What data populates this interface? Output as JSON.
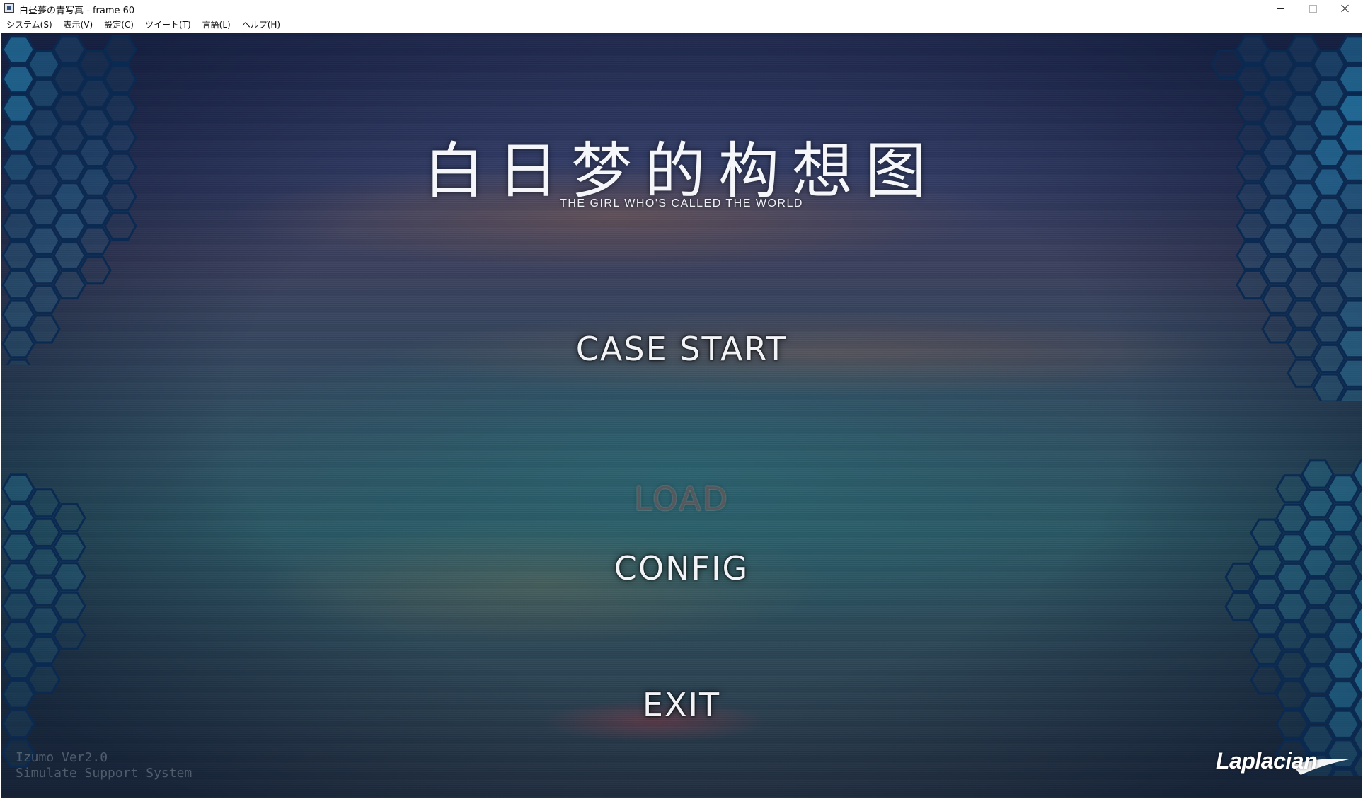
{
  "window": {
    "title": "白昼夢の青写真 - frame 60",
    "icon": "app-icon",
    "controls": [
      "minimize-icon",
      "maximize-icon",
      "close-icon"
    ]
  },
  "menubar": {
    "items": [
      {
        "label": "システム(S)"
      },
      {
        "label": "表示(V)"
      },
      {
        "label": "設定(C)"
      },
      {
        "label": "ツイート(T)"
      },
      {
        "label": "言語(L)"
      },
      {
        "label": "ヘルプ(H)"
      }
    ]
  },
  "game": {
    "title": "白日梦的构想图",
    "subtitle": "THE GIRL WHO'S CALLED THE WORLD",
    "menu": {
      "case_start": "CASE START",
      "load": "LOAD",
      "config": "CONFIG",
      "exit": "EXIT"
    },
    "version_line1": "Izumo Ver2.0",
    "version_line2": "Simulate Support System",
    "brand": "Laplacian",
    "colors": {
      "menu_text": "#f1f3f6",
      "disabled_text": "#55585c",
      "hex_accent": "#2aa3d8"
    }
  }
}
